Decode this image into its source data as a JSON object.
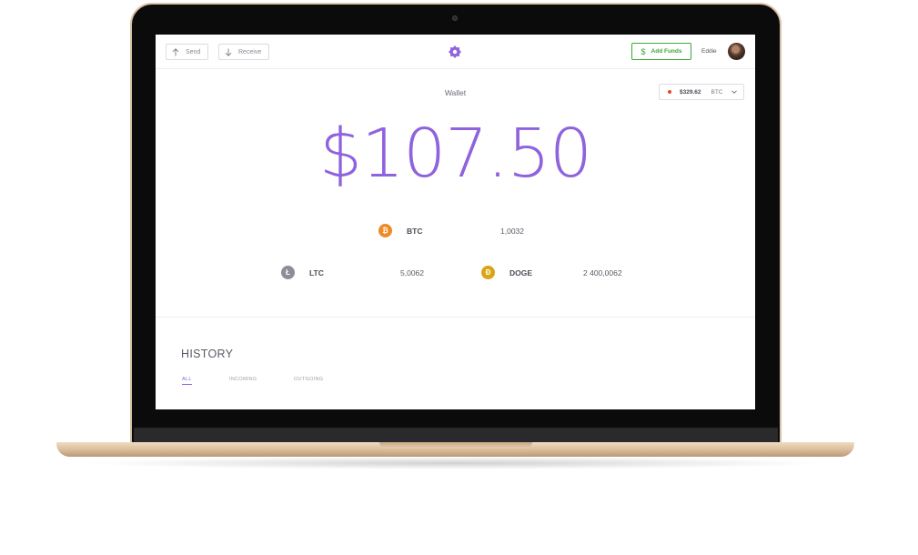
{
  "header": {
    "send_label": "Send",
    "receive_label": "Receive",
    "add_funds_label": "Add Funds",
    "add_funds_icon": "$",
    "username": "Eddie"
  },
  "wallet": {
    "label": "Wallet",
    "balance": "$107.50",
    "price_selector": {
      "price": "$329.62",
      "currency": "BTC"
    }
  },
  "coins": [
    {
      "symbol": "BTC",
      "icon": "bitcoin-icon",
      "glyph": "₿",
      "amount": "1,0032",
      "color": "#f08a24"
    },
    {
      "symbol": "LTC",
      "icon": "litecoin-icon",
      "glyph": "Ł",
      "amount": "5,0062",
      "color": "#8d8d95"
    },
    {
      "symbol": "DOGE",
      "icon": "dogecoin-icon",
      "glyph": "Ð",
      "amount": "2 400,0062",
      "color": "#d9a514"
    }
  ],
  "history": {
    "title": "HISTORY",
    "tabs": [
      {
        "label": "ALL",
        "active": true
      },
      {
        "label": "INCOMING",
        "active": false
      },
      {
        "label": "OUTGOING",
        "active": false
      }
    ]
  },
  "colors": {
    "accent": "#8f63dd",
    "add_funds": "#3aa83a",
    "laptop_gold": "#d9c2a5"
  }
}
